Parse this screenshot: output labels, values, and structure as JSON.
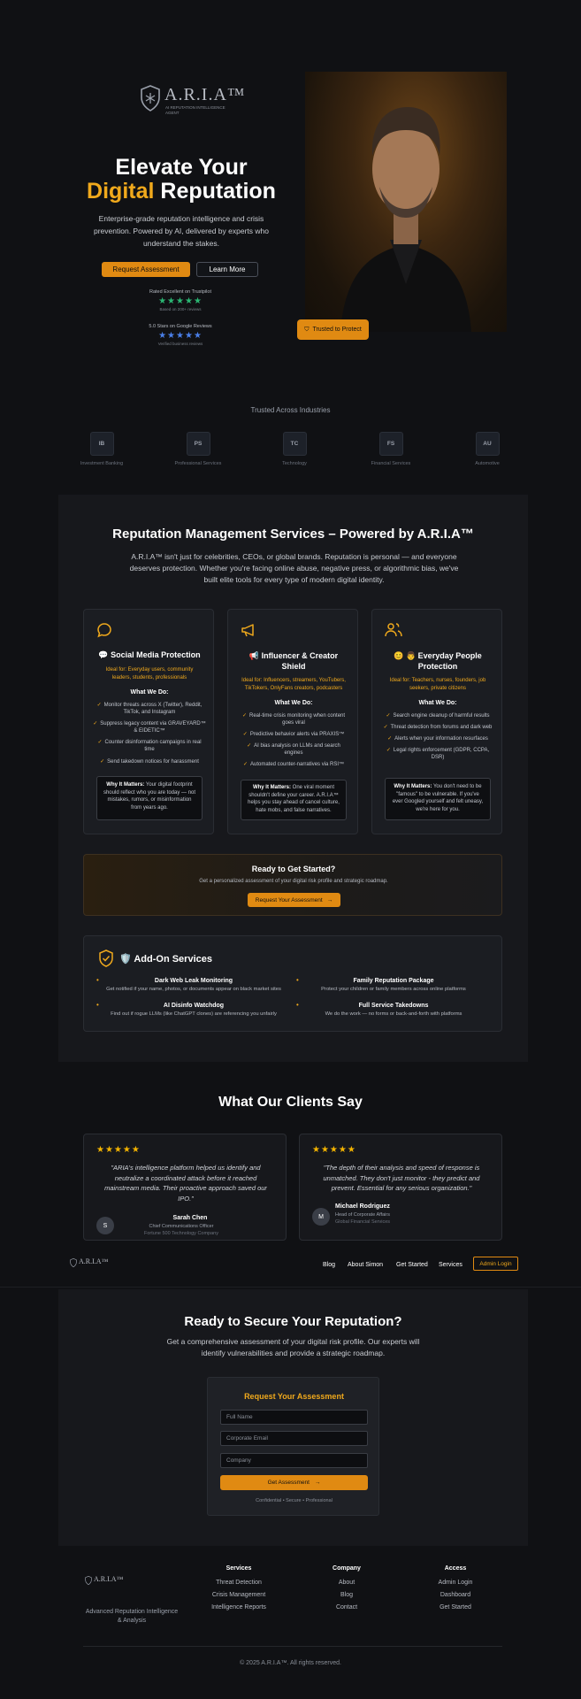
{
  "brand": {
    "logo_text": "A.R.I.A™",
    "tagline": "AI REPUTATION INTELLIGENCE AGENT"
  },
  "hero": {
    "title_line1": "Elevate Your",
    "title_gold": "Digital",
    "title_rest": "Reputation",
    "subtitle": "Enterprise-grade reputation intelligence and crisis prevention. Powered by AI, delivered by experts who understand the stakes.",
    "cta_primary": "Request Assessment",
    "cta_secondary": "Learn More",
    "trustpilot": {
      "label": "Rated Excellent on Trustpilot",
      "stars": "★★★★★",
      "note": "Based on 200+ reviews"
    },
    "google": {
      "label": "5.0 Stars on Google Reviews",
      "stars": "★★★★★",
      "note": "Verified business reviews"
    },
    "badge": "Trusted to Protect"
  },
  "industries": {
    "title": "Trusted Across Industries",
    "items": [
      {
        "abbr": "IB",
        "name": "Investment Banking"
      },
      {
        "abbr": "PS",
        "name": "Professional Services"
      },
      {
        "abbr": "TC",
        "name": "Technology"
      },
      {
        "abbr": "FS",
        "name": "Financial Services"
      },
      {
        "abbr": "AU",
        "name": "Automotive"
      }
    ]
  },
  "services": {
    "title": "Reputation Management Services – Powered by A.R.I.A™",
    "intro": "A.R.I.A™ isn't just for celebrities, CEOs, or global brands. Reputation is personal — and everyone deserves protection. Whether you're facing online abuse, negative press, or algorithmic bias, we've built elite tools for every type of modern digital identity.",
    "what_we_do": "What We Do:",
    "why_label": "Why It Matters:",
    "cards": [
      {
        "title": "💬 Social Media Protection",
        "ideal": "Ideal for: Everyday users, community leaders, students, professionals",
        "items": [
          "Monitor threats across X (Twitter), Reddit, TikTok, and Instagram",
          "Suppress legacy content via GRAVEYARD™ & EIDETIC™",
          "Counter disinformation campaigns in real time",
          "Send takedown notices for harassment"
        ],
        "why": "Your digital footprint should reflect who you are today — not mistakes, rumors, or misinformation from years ago."
      },
      {
        "title": "📢 Influencer & Creator Shield",
        "ideal": "Ideal for: Influencers, streamers, YouTubers, TikTokers, OnlyFans creators, podcasters",
        "items": [
          "Real-time crisis monitoring when content goes viral",
          "Predictive behavior alerts via PRAXIS™",
          "AI bias analysis on LLMs and search engines",
          "Automated counter-narratives via RSI™"
        ],
        "why": "One viral moment shouldn't define your career. A.R.I.A™ helps you stay ahead of cancel culture, hate mobs, and false narratives."
      },
      {
        "title": "😊 👨 Everyday People Protection",
        "ideal": "Ideal for: Teachers, nurses, founders, job seekers, private citizens",
        "items": [
          "Search engine cleanup of harmful results",
          "Threat detection from forums and dark web",
          "Alerts when your information resurfaces",
          "Legal rights enforcement (GDPR, CCPA, DSR)"
        ],
        "why": "You don't need to be \"famous\" to be vulnerable. If you've ever Googled yourself and felt uneasy, we're here for you."
      }
    ],
    "cta": {
      "title": "Ready to Get Started?",
      "text": "Get a personalized assessment of your digital risk profile and strategic roadmap.",
      "button": "Request Your Assessment"
    },
    "addons": {
      "title": "🛡️ Add-On Services",
      "items": [
        {
          "name": "Dark Web Leak Monitoring",
          "desc": "Get notified if your name, photos, or documents appear on black market sites"
        },
        {
          "name": "Family Reputation Package",
          "desc": "Protect your children or family members across online platforms"
        },
        {
          "name": "AI Disinfo Watchdog",
          "desc": "Find out if rogue LLMs (like ChatGPT clones) are referencing you unfairly"
        },
        {
          "name": "Full Service Takedowns",
          "desc": "We do the work — no forms or back-and-forth with platforms"
        }
      ]
    }
  },
  "testimonials": {
    "title": "What Our Clients Say",
    "items": [
      {
        "stars": "★★★★★",
        "quote": "\"ARIA's intelligence platform helped us identify and neutralize a coordinated attack before it reached mainstream media. Their proactive approach saved our IPO.\"",
        "initial": "S",
        "name": "Sarah Chen",
        "role": "Chief Communications Officer",
        "company": "Fortune 500 Technology Company"
      },
      {
        "stars": "★★★★★",
        "quote": "\"The depth of their analysis and speed of response is unmatched. They don't just monitor - they predict and prevent. Essential for any serious organization.\"",
        "initial": "M",
        "name": "Michael Rodriguez",
        "role": "Head of Corporate Affairs",
        "company": "Global Financial Services"
      }
    ]
  },
  "navbar": {
    "links": [
      "Blog",
      "About Simon",
      "Get Started",
      "Services"
    ],
    "admin": "Admin Login"
  },
  "secure": {
    "title": "Ready to Secure Your Reputation?",
    "text": "Get a comprehensive assessment of your digital risk profile. Our experts will identify vulnerabilities and provide a strategic roadmap.",
    "form": {
      "title": "Request Your Assessment",
      "name_ph": "Full Name",
      "email_ph": "Corporate Email",
      "company_ph": "Company",
      "button": "Get Assessment",
      "note": "Confidential • Secure • Professional"
    }
  },
  "footer": {
    "tagline": "Advanced Reputation Intelligence & Analysis",
    "cols": [
      {
        "title": "Services",
        "links": [
          "Threat Detection",
          "Crisis Management",
          "Intelligence Reports"
        ]
      },
      {
        "title": "Company",
        "links": [
          "About",
          "Blog",
          "Contact"
        ]
      },
      {
        "title": "Access",
        "links": [
          "Admin Login",
          "Dashboard",
          "Get Started"
        ]
      }
    ],
    "copyright": "© 2025 A.R.I.A™. All rights reserved."
  },
  "colors": {
    "accent": "#f0a91c",
    "button": "#e08a12",
    "bg": "#101114",
    "card": "#1b1d22"
  }
}
